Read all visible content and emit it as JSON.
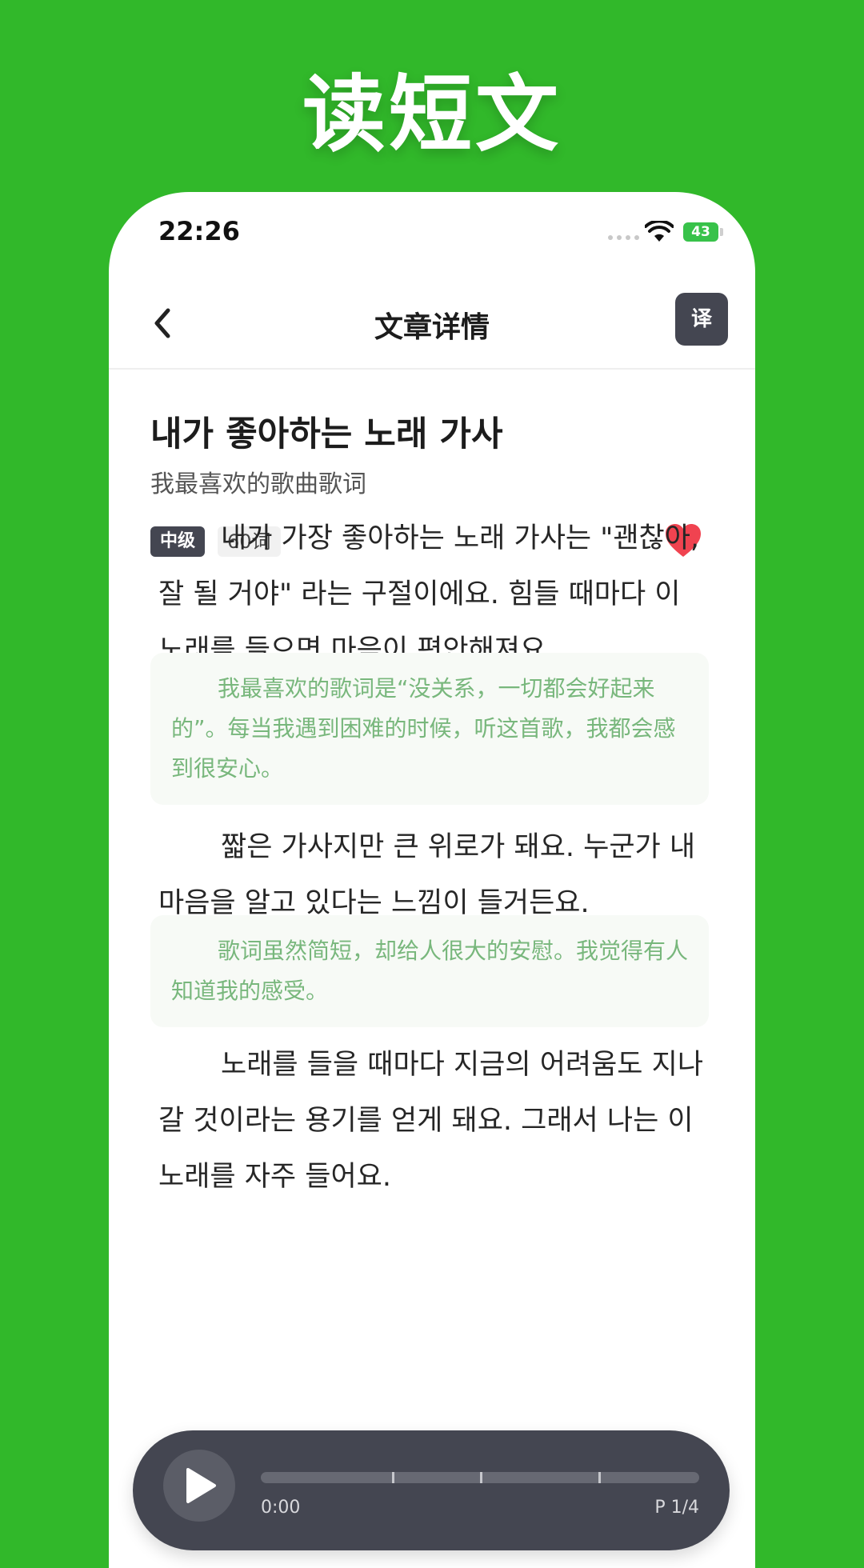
{
  "banner": {
    "title": "读短文"
  },
  "status_bar": {
    "time": "22:26",
    "battery": "43"
  },
  "nav": {
    "title": "文章详情",
    "translate_label": "译"
  },
  "article": {
    "title": "내가 좋아하는 노래 가사",
    "subtitle": "我最喜欢的歌曲歌词",
    "level": "中级",
    "word_count": "60词",
    "favorited": true,
    "paragraphs": [
      {
        "ko": "내가 가장 좋아하는 노래 가사는 \"괜찮아, 잘 될 거야\" 라는 구절이에요. 힘들 때마다 이 노래를 들으면 마음이 편안해져요.",
        "zh": "我最喜欢的歌词是“没关系，一切都会好起来的”。每当我遇到困难的时候，听这首歌，我都会感到很安心。"
      },
      {
        "ko": "짧은 가사지만 큰 위로가 돼요. 누군가 내 마음을 알고 있다는 느낌이 들거든요.",
        "zh": "歌词虽然简短，却给人很大的安慰。我觉得有人知道我的感受。"
      },
      {
        "ko": "노래를 들을 때마다 지금의 어려움도 지나갈 것이라는 용기를 얻게 돼요. 그래서 나는 이 노래를 자주 들어요."
      }
    ]
  },
  "player": {
    "current_time": "0:00",
    "page": "P 1/4",
    "progress": 0,
    "segment_marks": [
      0.3,
      0.5,
      0.77
    ]
  },
  "colors": {
    "background": "#31b82a",
    "accent_dark": "#444651",
    "heart": "#f04350",
    "translation_text": "#78b77c"
  }
}
